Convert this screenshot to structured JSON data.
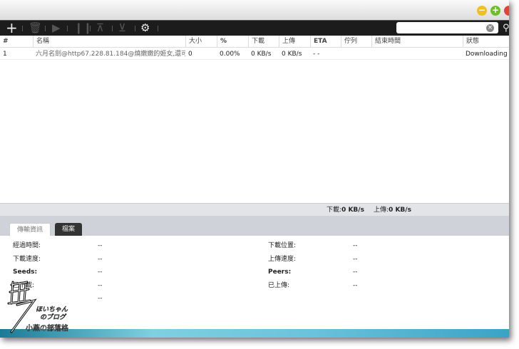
{
  "window": {
    "buttons": [
      {
        "name": "minimize",
        "symbol": "−",
        "color": "#f0c020"
      },
      {
        "name": "zoom",
        "symbol": "+",
        "color": "#6cbf2a"
      },
      {
        "name": "close",
        "symbol": "",
        "color": "#e0443a"
      }
    ]
  },
  "toolbar": {
    "icons": [
      "plus-icon",
      "trash-icon",
      "play-icon",
      "pause-icon",
      "move-top-icon",
      "move-bottom-icon",
      "gear-icon"
    ],
    "search_placeholder": "",
    "clear_symbol": "×"
  },
  "table": {
    "headers": [
      "#",
      "名稱",
      "大小",
      "%",
      "下載",
      "上傳",
      "ETA",
      "佇列",
      "結束時間",
      "狀態"
    ],
    "rows": [
      {
        "num": "1",
        "name": "六月名劍@http67.228.81.184@燒嫩嫩的姬女,還可...",
        "size": "0",
        "percent": "0.00%",
        "down": "0 KB/s",
        "up": "0 KB/s",
        "eta": "- -",
        "queue": "",
        "finish": "",
        "status": "Downloading"
      }
    ]
  },
  "status": {
    "down_label": "下載:",
    "down_value": "0 KB/s",
    "up_label": "上傳:",
    "up_value": "0 KB/s"
  },
  "tabs": [
    {
      "label": "傳輸資訊",
      "active": true
    },
    {
      "label": "檔案",
      "active": false
    }
  ],
  "details": {
    "left": [
      {
        "label": "經過時間:",
        "value": "--"
      },
      {
        "label": "下載速度:",
        "value": "--"
      },
      {
        "label": "Seeds:",
        "value": "--"
      },
      {
        "label": "已下載:",
        "value": "--"
      },
      {
        "label": "",
        "value": "--"
      }
    ],
    "right": [
      {
        "label": "下載位置:",
        "value": "--"
      },
      {
        "label": "上傳速度:",
        "value": "--"
      },
      {
        "label": "Peers:",
        "value": "--"
      },
      {
        "label": "已上傳:",
        "value": "--"
      }
    ]
  },
  "watermark": {
    "text": "無手 ほいちゃんのブログ 小燕の部落格"
  }
}
